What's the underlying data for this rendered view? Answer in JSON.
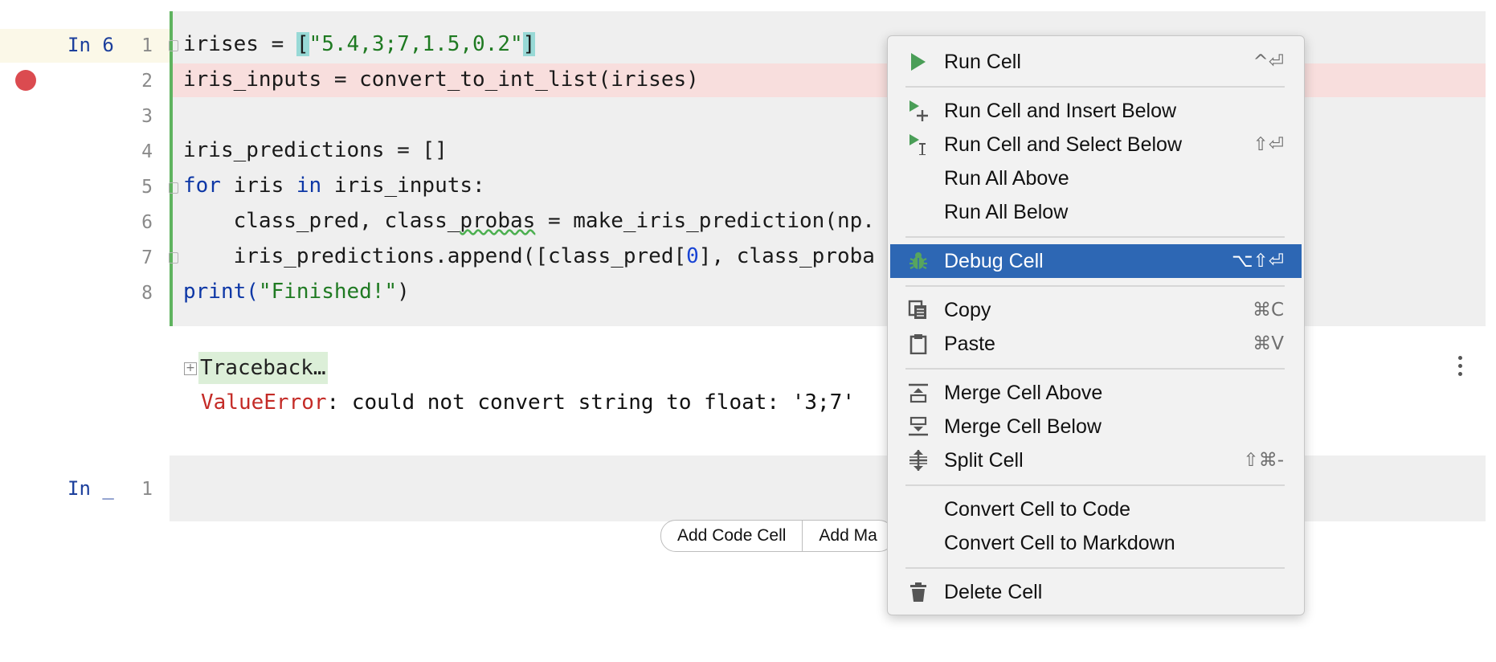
{
  "cell1": {
    "prompt": "In 6",
    "line_numbers": [
      "1",
      "2",
      "3",
      "4",
      "5",
      "6",
      "7",
      "8"
    ],
    "lines": {
      "l1_a": "irises = ",
      "l1_b": "[",
      "l1_c": "\"5.4,3;7,1.5,0.2\"",
      "l1_d": "]",
      "l2": "iris_inputs = convert_to_int_list(irises)",
      "l4": "iris_predictions = []",
      "l5_kw1": "for",
      "l5_a": " iris ",
      "l5_kw2": "in",
      "l5_b": " iris_inputs:",
      "l6_a": "    class_pred, class_",
      "l6_b": "probas",
      "l6_c": " = make_iris_prediction(np.",
      "l7_a": "    iris_predictions.append([class_pred[",
      "l7_b": "0",
      "l7_c": "], class_proba",
      "l8_a": "print(",
      "l8_b": "\"Finished!\"",
      "l8_c": ")"
    }
  },
  "output": {
    "traceback_label": "Traceback…",
    "error_name": "ValueError",
    "error_message": ": could not convert string to float: '3;7'"
  },
  "cell2": {
    "prompt": "In _",
    "line_number": "1"
  },
  "add_buttons": {
    "code": "Add Code Cell",
    "markdown": "Add Ma"
  },
  "menu": {
    "run_cell": {
      "label": "Run Cell",
      "shortcut": "^⏎"
    },
    "run_insert_below": {
      "label": "Run Cell and Insert Below",
      "shortcut": ""
    },
    "run_select_below": {
      "label": "Run Cell and Select Below",
      "shortcut": "⇧⏎"
    },
    "run_all_above": {
      "label": "Run All Above",
      "shortcut": ""
    },
    "run_all_below": {
      "label": "Run All Below",
      "shortcut": ""
    },
    "debug_cell": {
      "label": "Debug Cell",
      "shortcut": "⌥⇧⏎"
    },
    "copy": {
      "label": "Copy",
      "shortcut": "⌘C"
    },
    "paste": {
      "label": "Paste",
      "shortcut": "⌘V"
    },
    "merge_above": {
      "label": "Merge Cell Above",
      "shortcut": ""
    },
    "merge_below": {
      "label": "Merge Cell Below",
      "shortcut": ""
    },
    "split_cell": {
      "label": "Split Cell",
      "shortcut": "⇧⌘-"
    },
    "convert_code": {
      "label": "Convert Cell to Code",
      "shortcut": ""
    },
    "convert_markdown": {
      "label": "Convert Cell to Markdown",
      "shortcut": ""
    },
    "delete_cell": {
      "label": "Delete Cell",
      "shortcut": ""
    }
  },
  "icons": {
    "run": "play-icon",
    "run_insert": "play-plus-icon",
    "run_select": "play-cursor-icon",
    "debug": "bug-icon",
    "copy": "copy-icon",
    "paste": "clipboard-icon",
    "merge_above": "merge-above-icon",
    "merge_below": "merge-below-icon",
    "split": "split-icon",
    "delete": "trash-icon"
  },
  "colors": {
    "selection": "#2d67b4",
    "run_green": "#4a9e57",
    "breakpoint_red": "#db4b50",
    "cell_bar_green": "#5fb35f"
  }
}
